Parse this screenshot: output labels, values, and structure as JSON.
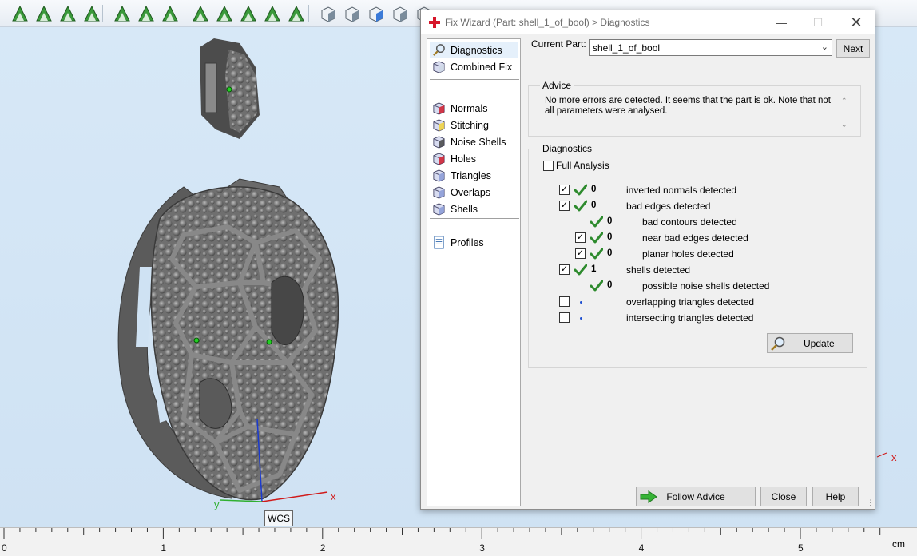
{
  "toolbar": {
    "icons": [
      "select-triangle-icon",
      "select-surface-icon",
      "select-curve-icon",
      "select-shell-icon",
      "mark-triangle-icon",
      "mark-surface-icon",
      "mark-curve-icon",
      "mark-plane-icon",
      "mark-shell-icon",
      "mark-polyline-icon",
      "mark-sphere-icon",
      "mark-box-icon",
      "view-front-icon",
      "view-back-icon",
      "view-left-icon",
      "view-right-icon",
      "view-top-icon"
    ]
  },
  "viewport": {
    "wcs_label": "WCS",
    "axis_x": "x",
    "axis_y": "y"
  },
  "ruler": {
    "unit": "cm",
    "ticks": [
      "0",
      "1",
      "2",
      "3",
      "4",
      "5"
    ]
  },
  "dialog": {
    "title": "Fix Wizard (Part: shell_1_of_bool) > Diagnostics",
    "nav": {
      "group1": [
        {
          "label": "Diagnostics",
          "icon": "magnifier-icon",
          "selected": true
        },
        {
          "label": "Combined Fix",
          "icon": "combined-fix-icon"
        }
      ],
      "group2": [
        {
          "label": "Normals",
          "icon": "normals-cube-icon"
        },
        {
          "label": "Stitching",
          "icon": "stitching-cube-icon"
        },
        {
          "label": "Noise Shells",
          "icon": "noise-shells-cube-icon"
        },
        {
          "label": "Holes",
          "icon": "holes-cube-icon"
        },
        {
          "label": "Triangles",
          "icon": "triangles-cube-icon"
        },
        {
          "label": "Overlaps",
          "icon": "overlaps-cube-icon"
        },
        {
          "label": "Shells",
          "icon": "shells-cube-icon"
        }
      ],
      "group3": [
        {
          "label": "Profiles",
          "icon": "profiles-document-icon"
        }
      ]
    },
    "current_part_label": "Current Part:",
    "current_part_value": "shell_1_of_bool",
    "next_label": "Next",
    "advice_title": "Advice",
    "advice_text": "No more errors are detected. It seems that the part is ok. Note that not all parameters were analysed.",
    "diagnostics_title": "Diagnostics",
    "full_analysis_label": "Full Analysis",
    "full_analysis_checked": false,
    "rows": [
      {
        "checkbox": true,
        "checked": true,
        "status": "check",
        "count": "0",
        "label": "inverted normals detected",
        "indent": 0
      },
      {
        "checkbox": true,
        "checked": true,
        "status": "check",
        "count": "0",
        "label": "bad edges detected",
        "indent": 0
      },
      {
        "checkbox": false,
        "checked": false,
        "status": "check",
        "count": "0",
        "label": "bad contours detected",
        "indent": 1
      },
      {
        "checkbox": true,
        "checked": true,
        "status": "check",
        "count": "0",
        "label": "near bad edges detected",
        "indent": 1
      },
      {
        "checkbox": true,
        "checked": true,
        "status": "check",
        "count": "0",
        "label": "planar holes detected",
        "indent": 1
      },
      {
        "checkbox": true,
        "checked": true,
        "status": "check",
        "count": "1",
        "label": "shells detected",
        "indent": 0
      },
      {
        "checkbox": false,
        "checked": false,
        "status": "check",
        "count": "0",
        "label": "possible noise shells detected",
        "indent": 1
      },
      {
        "checkbox": true,
        "checked": false,
        "status": "dot",
        "count": "",
        "label": "overlapping triangles detected",
        "indent": 0
      },
      {
        "checkbox": true,
        "checked": false,
        "status": "dot",
        "count": "",
        "label": "intersecting triangles detected",
        "indent": 0
      }
    ],
    "update_label": "Update",
    "follow_advice_label": "Follow Advice",
    "close_label": "Close",
    "help_label": "Help"
  }
}
